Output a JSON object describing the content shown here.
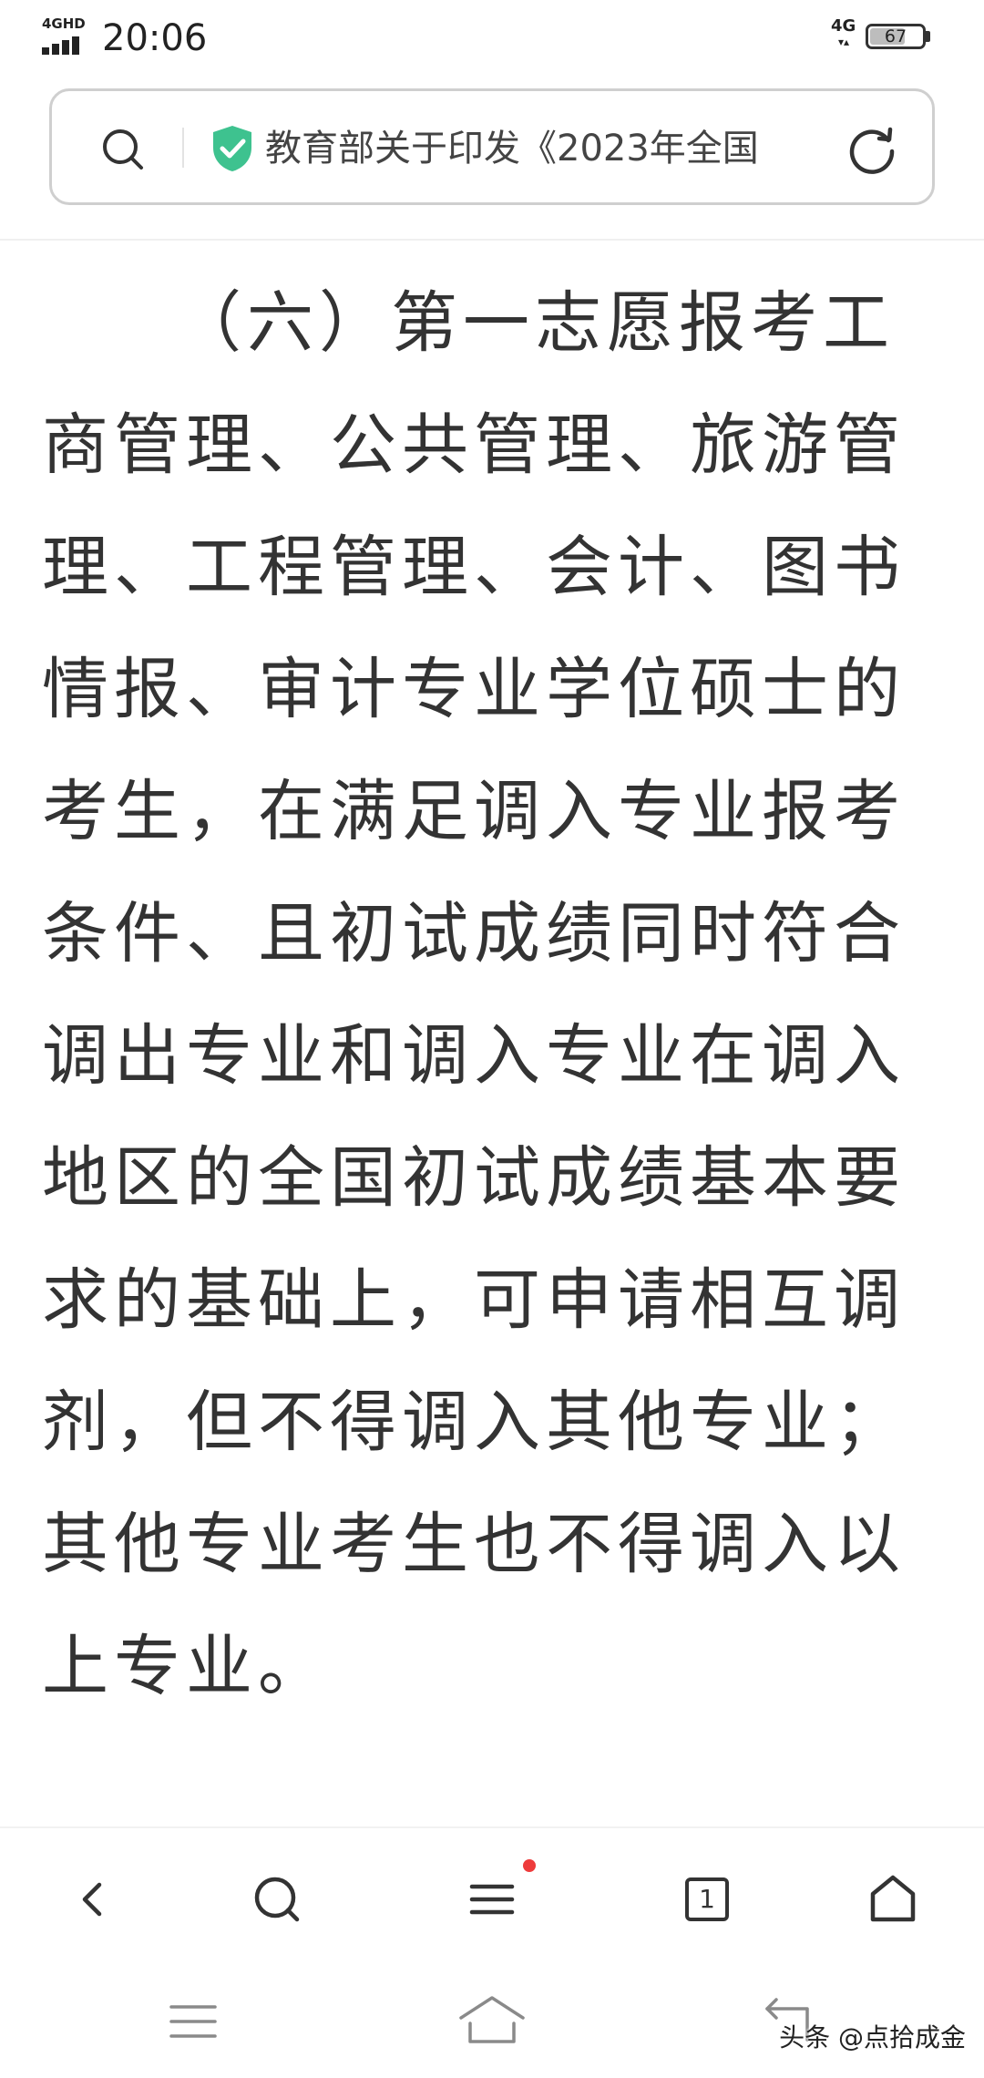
{
  "status_bar": {
    "network_label": "4GHD",
    "time": "20:06",
    "mobile_data_label": "4G",
    "battery_level": "67",
    "battery_fraction": 0.67
  },
  "address_bar": {
    "search_icon": "search-icon",
    "security_icon": "shield-check-icon",
    "security_color": "#3ec28f",
    "page_title": "教育部关于印发《2023年全国",
    "reload_icon": "reload-icon"
  },
  "article": {
    "paragraph": "（六）第一志愿报考工商管理、公共管理、旅游管理、工程管理、会计、图书情报、审计专业学位硕士的考生，在满足调入专业报考条件、且初试成绩同时符合调出专业和调入专业在调入地区的全国初试成绩基本要求的基础上，可申请相互调剂，但不得调入其他专业；其他专业考生也不得调入以上专业。"
  },
  "toolbar": {
    "back_icon": "chevron-left-icon",
    "search_icon": "search-icon",
    "menu_icon": "menu-icon",
    "menu_badge_color": "#ee3b3b",
    "tab_count": "1",
    "home_icon": "home-icon"
  },
  "system_nav": {
    "menu_icon": "menu-icon",
    "home_icon": "home-icon",
    "back_icon": "back-icon",
    "watermark": "头条 @点拾成金"
  }
}
